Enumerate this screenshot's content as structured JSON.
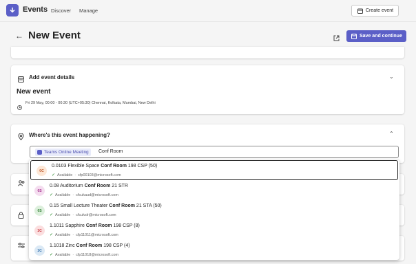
{
  "topbar": {
    "app_name": "Events",
    "nav": [
      "Discover",
      "Manage"
    ],
    "create_label": "Create event"
  },
  "header": {
    "title": "New Event",
    "save_label": "Save and continue"
  },
  "details_card": {
    "title": "Add event details",
    "event_name": "New event",
    "date_text": "Fri 29 May, 00:00 - 00:30 (UTC+05:30) Chennai, Kolkata, Mumbai, New Delhi"
  },
  "location_card": {
    "title": "Where's this event happening?",
    "chip_label": "Teams Online Meeting",
    "query": "Conf Room"
  },
  "rooms": [
    {
      "avatar": "0C",
      "name_pre": "0.0103 Flexible Space ",
      "name_match": "Conf Room",
      "name_post": " 198 CSP (50)",
      "status": "Available",
      "email": "cfp00103@microsoft.com",
      "avatar_bg": "#fde7d6",
      "avatar_fg": "#c0592d"
    },
    {
      "avatar": "0S",
      "name_pre": "0.08 Auditorium ",
      "name_match": "Conf Room",
      "name_post": " 21 STR",
      "status": "Available",
      "email": "cfcukaud@microsoft.com",
      "avatar_bg": "#f4dcef",
      "avatar_fg": "#a5318f"
    },
    {
      "avatar": "0S",
      "name_pre": "0.15 Small Lecture Theater ",
      "name_match": "Conf Room",
      "name_post": " 21 STA (50)",
      "status": "Available",
      "email": "cfcukslr@microsoft.com",
      "avatar_bg": "#dcefdc",
      "avatar_fg": "#2e7d32"
    },
    {
      "avatar": "1C",
      "name_pre": "1.1011 Sapphire ",
      "name_match": "Conf Room",
      "name_post": " 198 CSP (8)",
      "status": "Available",
      "email": "cfp11011@microsoft.com",
      "avatar_bg": "#fbdedf",
      "avatar_fg": "#c62f38"
    },
    {
      "avatar": "1C",
      "name_pre": "1.1018 Zinc ",
      "name_match": "Conf Room",
      "name_post": " 198 CSP (4)",
      "status": "Available",
      "email": "cfp11018@microsoft.com",
      "avatar_bg": "#dbe9f5",
      "avatar_fg": "#2b6aa8"
    }
  ],
  "colors": {
    "brand": "#5b5fc7",
    "available": "#107c10"
  }
}
